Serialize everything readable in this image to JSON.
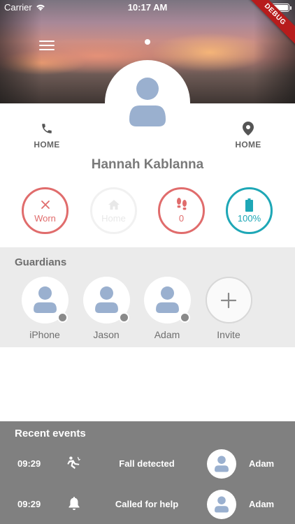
{
  "status_bar": {
    "carrier": "Carrier",
    "time": "10:17 AM"
  },
  "debug_banner": "DEBUG",
  "profile": {
    "name": "Hannah Kablanna",
    "contacts": [
      {
        "label": "HOME",
        "icon": "phone-icon"
      },
      {
        "label": "HOME",
        "icon": "location-pin-icon"
      }
    ]
  },
  "stats": [
    {
      "id": "worn",
      "icon": "close-icon",
      "value": "Worn",
      "color": "#e06c6c"
    },
    {
      "id": "home",
      "icon": "home-icon",
      "value": "Home",
      "color": "#e8e8e8"
    },
    {
      "id": "steps",
      "icon": "footsteps-icon",
      "value": "0",
      "color": "#e06c6c"
    },
    {
      "id": "battery",
      "icon": "battery-icon",
      "value": "100%",
      "color": "#1ea7b6"
    }
  ],
  "guardians": {
    "title": "Guardians",
    "items": [
      {
        "name": "iPhone"
      },
      {
        "name": "Jason"
      },
      {
        "name": "Adam"
      }
    ],
    "invite_label": "Invite"
  },
  "recent_events": {
    "title": "Recent events",
    "items": [
      {
        "time": "09:29",
        "icon": "fall-icon",
        "text": "Fall detected",
        "person": "Adam"
      },
      {
        "time": "09:29",
        "icon": "bell-icon",
        "text": "Called for help",
        "person": "Adam"
      }
    ]
  },
  "colors": {
    "alert": "#e06c6c",
    "battery": "#1ea7b6",
    "avatar": "#9ab0cf",
    "events_bg": "#808080",
    "guardians_bg": "#ebebeb"
  }
}
